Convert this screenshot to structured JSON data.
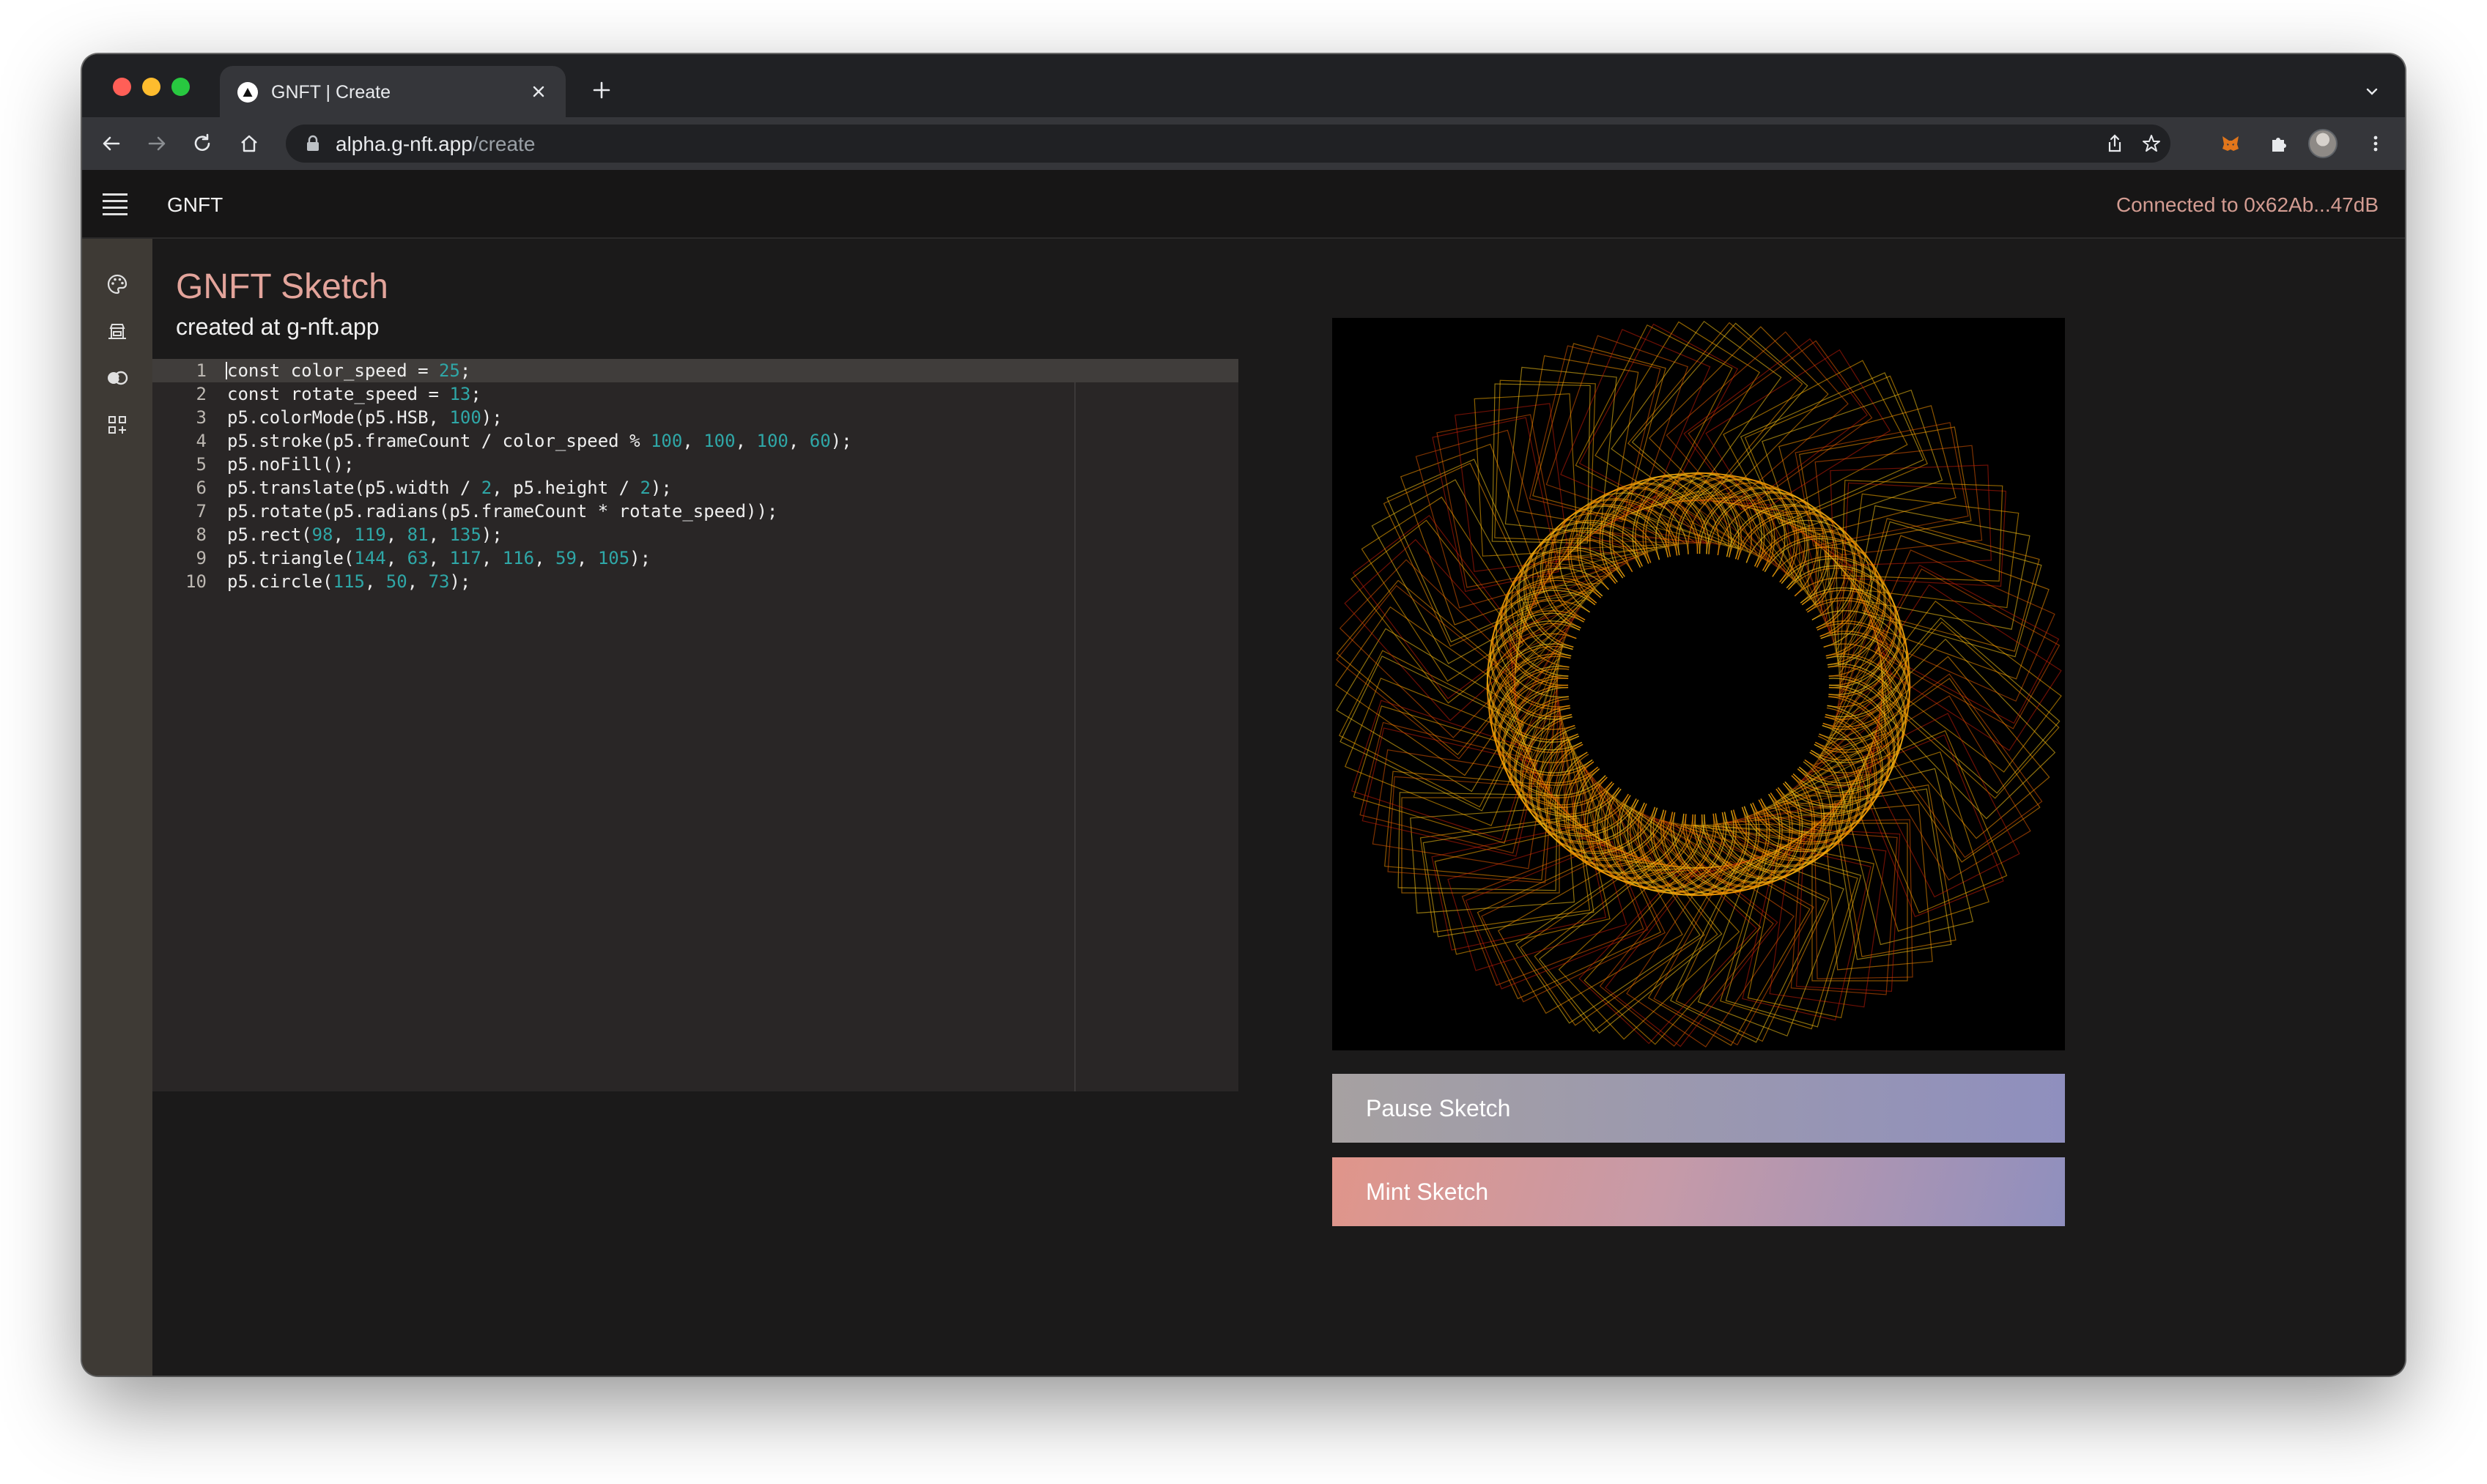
{
  "browser": {
    "tab_title": "GNFT | Create",
    "url_host": "alpha.g-nft.app",
    "url_path": "/create"
  },
  "app": {
    "brand": "GNFT",
    "connection_status": "Connected to 0x62Ab...47dB"
  },
  "sidebar": {
    "items": [
      {
        "icon": "palette-icon"
      },
      {
        "icon": "store-icon"
      },
      {
        "icon": "collection-icon"
      },
      {
        "icon": "apps-icon"
      }
    ]
  },
  "sketch": {
    "title": "GNFT Sketch",
    "subtitle": "created at g-nft.app"
  },
  "editor": {
    "lines": [
      {
        "n": "1",
        "code": "const color_speed = 25;"
      },
      {
        "n": "2",
        "code": "const rotate_speed = 13;"
      },
      {
        "n": "3",
        "code": "p5.colorMode(p5.HSB, 100);"
      },
      {
        "n": "4",
        "code": "p5.stroke(p5.frameCount / color_speed % 100, 100, 100, 60);"
      },
      {
        "n": "5",
        "code": "p5.noFill();"
      },
      {
        "n": "6",
        "code": "p5.translate(p5.width / 2, p5.height / 2);"
      },
      {
        "n": "7",
        "code": "p5.rotate(p5.radians(p5.frameCount * rotate_speed));"
      },
      {
        "n": "8",
        "code": "p5.rect(98, 119, 81, 135);"
      },
      {
        "n": "9",
        "code": "p5.triangle(144, 63, 117, 116, 59, 105);"
      },
      {
        "n": "10",
        "code": "p5.circle(115, 50, 73);"
      }
    ]
  },
  "actions": {
    "pause_label": "Pause Sketch",
    "mint_label": "Mint Sketch"
  },
  "colors": {
    "accent": "#e3a49b",
    "number": "#2fa7a7",
    "sidebar": "#3e3a35"
  }
}
